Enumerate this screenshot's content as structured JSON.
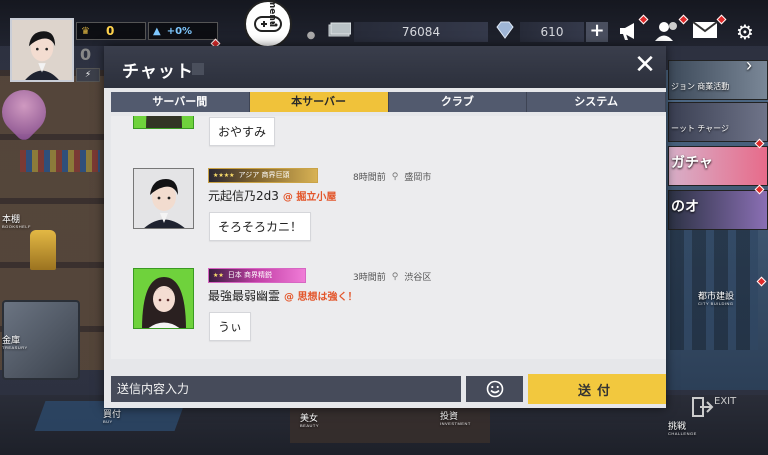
{
  "hud": {
    "level_value": "0",
    "level_small": "0",
    "growth_value": "+0%",
    "menu_label": "menu",
    "money_value": "76084",
    "gems_value": "610",
    "plus_label": "+"
  },
  "scene_labels": {
    "bookshelf": "本棚",
    "bookshelf_sub": "BOOKSHELF",
    "safe": "金庫",
    "safe_sub": "TREASURY",
    "buy": "買付",
    "buy_sub": "BUY",
    "beauty": "美女",
    "beauty_sub": "BEAUTY",
    "investment": "投資",
    "investment_sub": "INVESTMENT",
    "city": "都市建設",
    "city_sub": "CITY BUILDING",
    "challenge": "挑戦",
    "challenge_sub": "CHALLENGE",
    "exit": "EXIT",
    "gacha": "ガチャ",
    "side_text": "のオ",
    "side_text2": "ジョン 商業活動",
    "side_text3": "ーット チャージ"
  },
  "chat": {
    "title": "チャット",
    "close_label": "✕",
    "tabs": [
      {
        "label": "サーバー間",
        "active": false
      },
      {
        "label": "本サーバー",
        "active": true
      },
      {
        "label": "クラブ",
        "active": false
      },
      {
        "label": "システム",
        "active": false
      }
    ],
    "messages": [
      {
        "text": "おやすみ"
      },
      {
        "badge_stars": "★★★★",
        "badge_text": "アジア 商界巨頭",
        "time": "8時間前",
        "location": "盛岡市",
        "name": "元起信乃2d3",
        "club": "@ 掘立小屋",
        "text": "そろそろカニ！"
      },
      {
        "badge_stars": "★★",
        "badge_text": "日本 商界精鋭",
        "time": "3時間前",
        "location": "渋谷区",
        "name": "最強最弱幽霊",
        "club": "@ 思想は強く！",
        "text": "うぃ"
      }
    ],
    "input_placeholder": "送信内容入力",
    "send_label": "送付"
  },
  "colors": {
    "active_tab": "#f0c23a",
    "inactive_tab": "#525a6e",
    "send_button": "#f2c83e",
    "club_tag": "#e3562b",
    "header": "#2f3340"
  }
}
